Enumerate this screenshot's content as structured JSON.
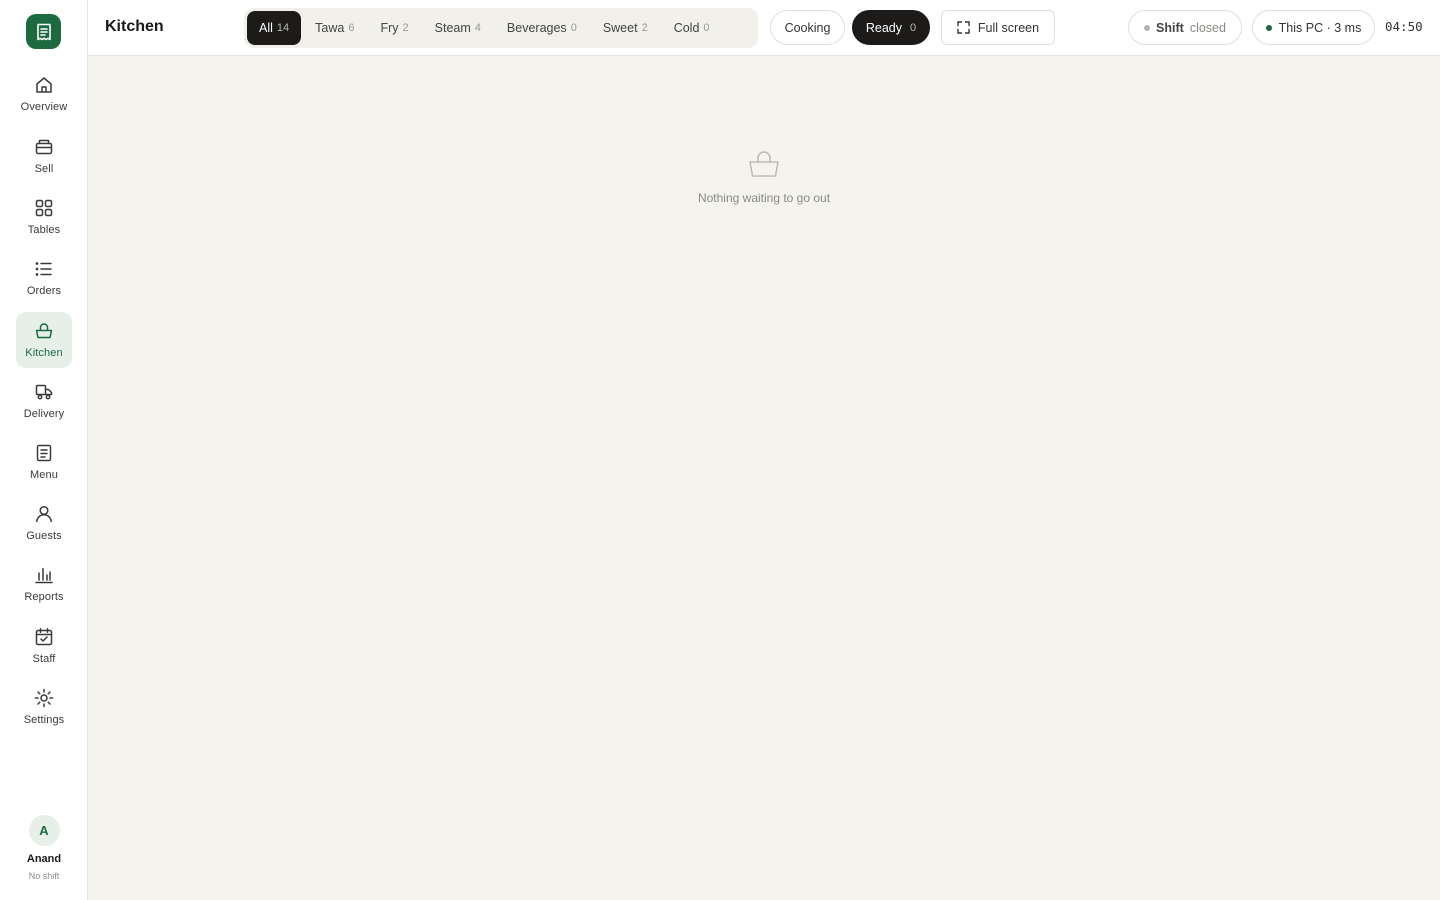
{
  "app": {
    "title": "Kitchen"
  },
  "sidebar": {
    "items": [
      {
        "label": "Overview",
        "icon": "home-icon"
      },
      {
        "label": "Sell",
        "icon": "register-icon"
      },
      {
        "label": "Tables",
        "icon": "grid-icon"
      },
      {
        "label": "Orders",
        "icon": "list-icon"
      },
      {
        "label": "Kitchen",
        "icon": "basket-icon",
        "active": true
      },
      {
        "label": "Delivery",
        "icon": "delivery-icon"
      },
      {
        "label": "Menu",
        "icon": "menu-icon"
      },
      {
        "label": "Guests",
        "icon": "user-icon"
      },
      {
        "label": "Reports",
        "icon": "bar-chart-icon"
      },
      {
        "label": "Staff",
        "icon": "calendar-check-icon"
      },
      {
        "label": "Settings",
        "icon": "sun-gear-icon"
      }
    ],
    "user": {
      "initial": "A",
      "name": "Anand",
      "shift": "No shift"
    }
  },
  "header": {
    "stations": [
      {
        "label": "All",
        "count": "14",
        "active": true
      },
      {
        "label": "Tawa",
        "count": "6"
      },
      {
        "label": "Fry",
        "count": "2"
      },
      {
        "label": "Steam",
        "count": "4"
      },
      {
        "label": "Beverages",
        "count": "0"
      },
      {
        "label": "Sweet",
        "count": "2"
      },
      {
        "label": "Cold",
        "count": "0"
      }
    ],
    "filters": {
      "cooking_label": "Cooking",
      "ready_label": "Ready",
      "ready_count": "0"
    },
    "fullscreen_label": "Full screen",
    "shift": {
      "label": "Shift",
      "status": "closed"
    },
    "connection": {
      "label": "This PC · 3 ms"
    },
    "clock": "04:50"
  },
  "main": {
    "empty_message": "Nothing waiting to go out"
  },
  "colors": {
    "brand": "#1e6a40",
    "active_bg": "#e6efe8",
    "dark_pill": "#1c1b19",
    "connection_dot": "#1e6a40",
    "shift_dot": "#b3b2ac"
  }
}
